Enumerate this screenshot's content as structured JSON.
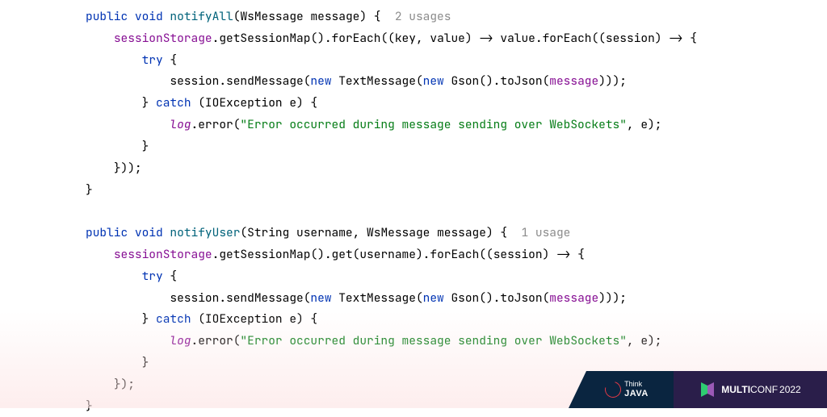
{
  "code": {
    "kw_public": "public",
    "kw_void": "void",
    "kw_try": "try",
    "kw_catch": "catch",
    "kw_new": "new",
    "m_notifyAll": "notifyAll",
    "m_notifyUser": "notifyUser",
    "t_WsMessage": "WsMessage",
    "t_String": "String",
    "t_TextMessage": "TextMessage",
    "t_Gson": "Gson",
    "t_IOException": "IOException",
    "p_message": "message",
    "p_username": "username",
    "p_key": "key",
    "p_value": "value",
    "p_session": "session",
    "p_e": "e",
    "f_sessionStorage": "sessionStorage",
    "f_log": "log",
    "m_getSessionMap": "getSessionMap",
    "m_forEach": "forEach",
    "m_get": "get",
    "m_sendMessage": "sendMessage",
    "m_toJson": "toJson",
    "m_error": "error",
    "str_error": "\"Error occurred during message sending over WebSockets\"",
    "hint_2usages": "2 usages",
    "hint_1usage": "1 usage"
  },
  "footer": {
    "thinkjava_l1": "Think",
    "thinkjava_l2": "JAVA",
    "multiconf_bold": "MULTI",
    "multiconf_thin": "CONF",
    "multiconf_year": "2022"
  }
}
